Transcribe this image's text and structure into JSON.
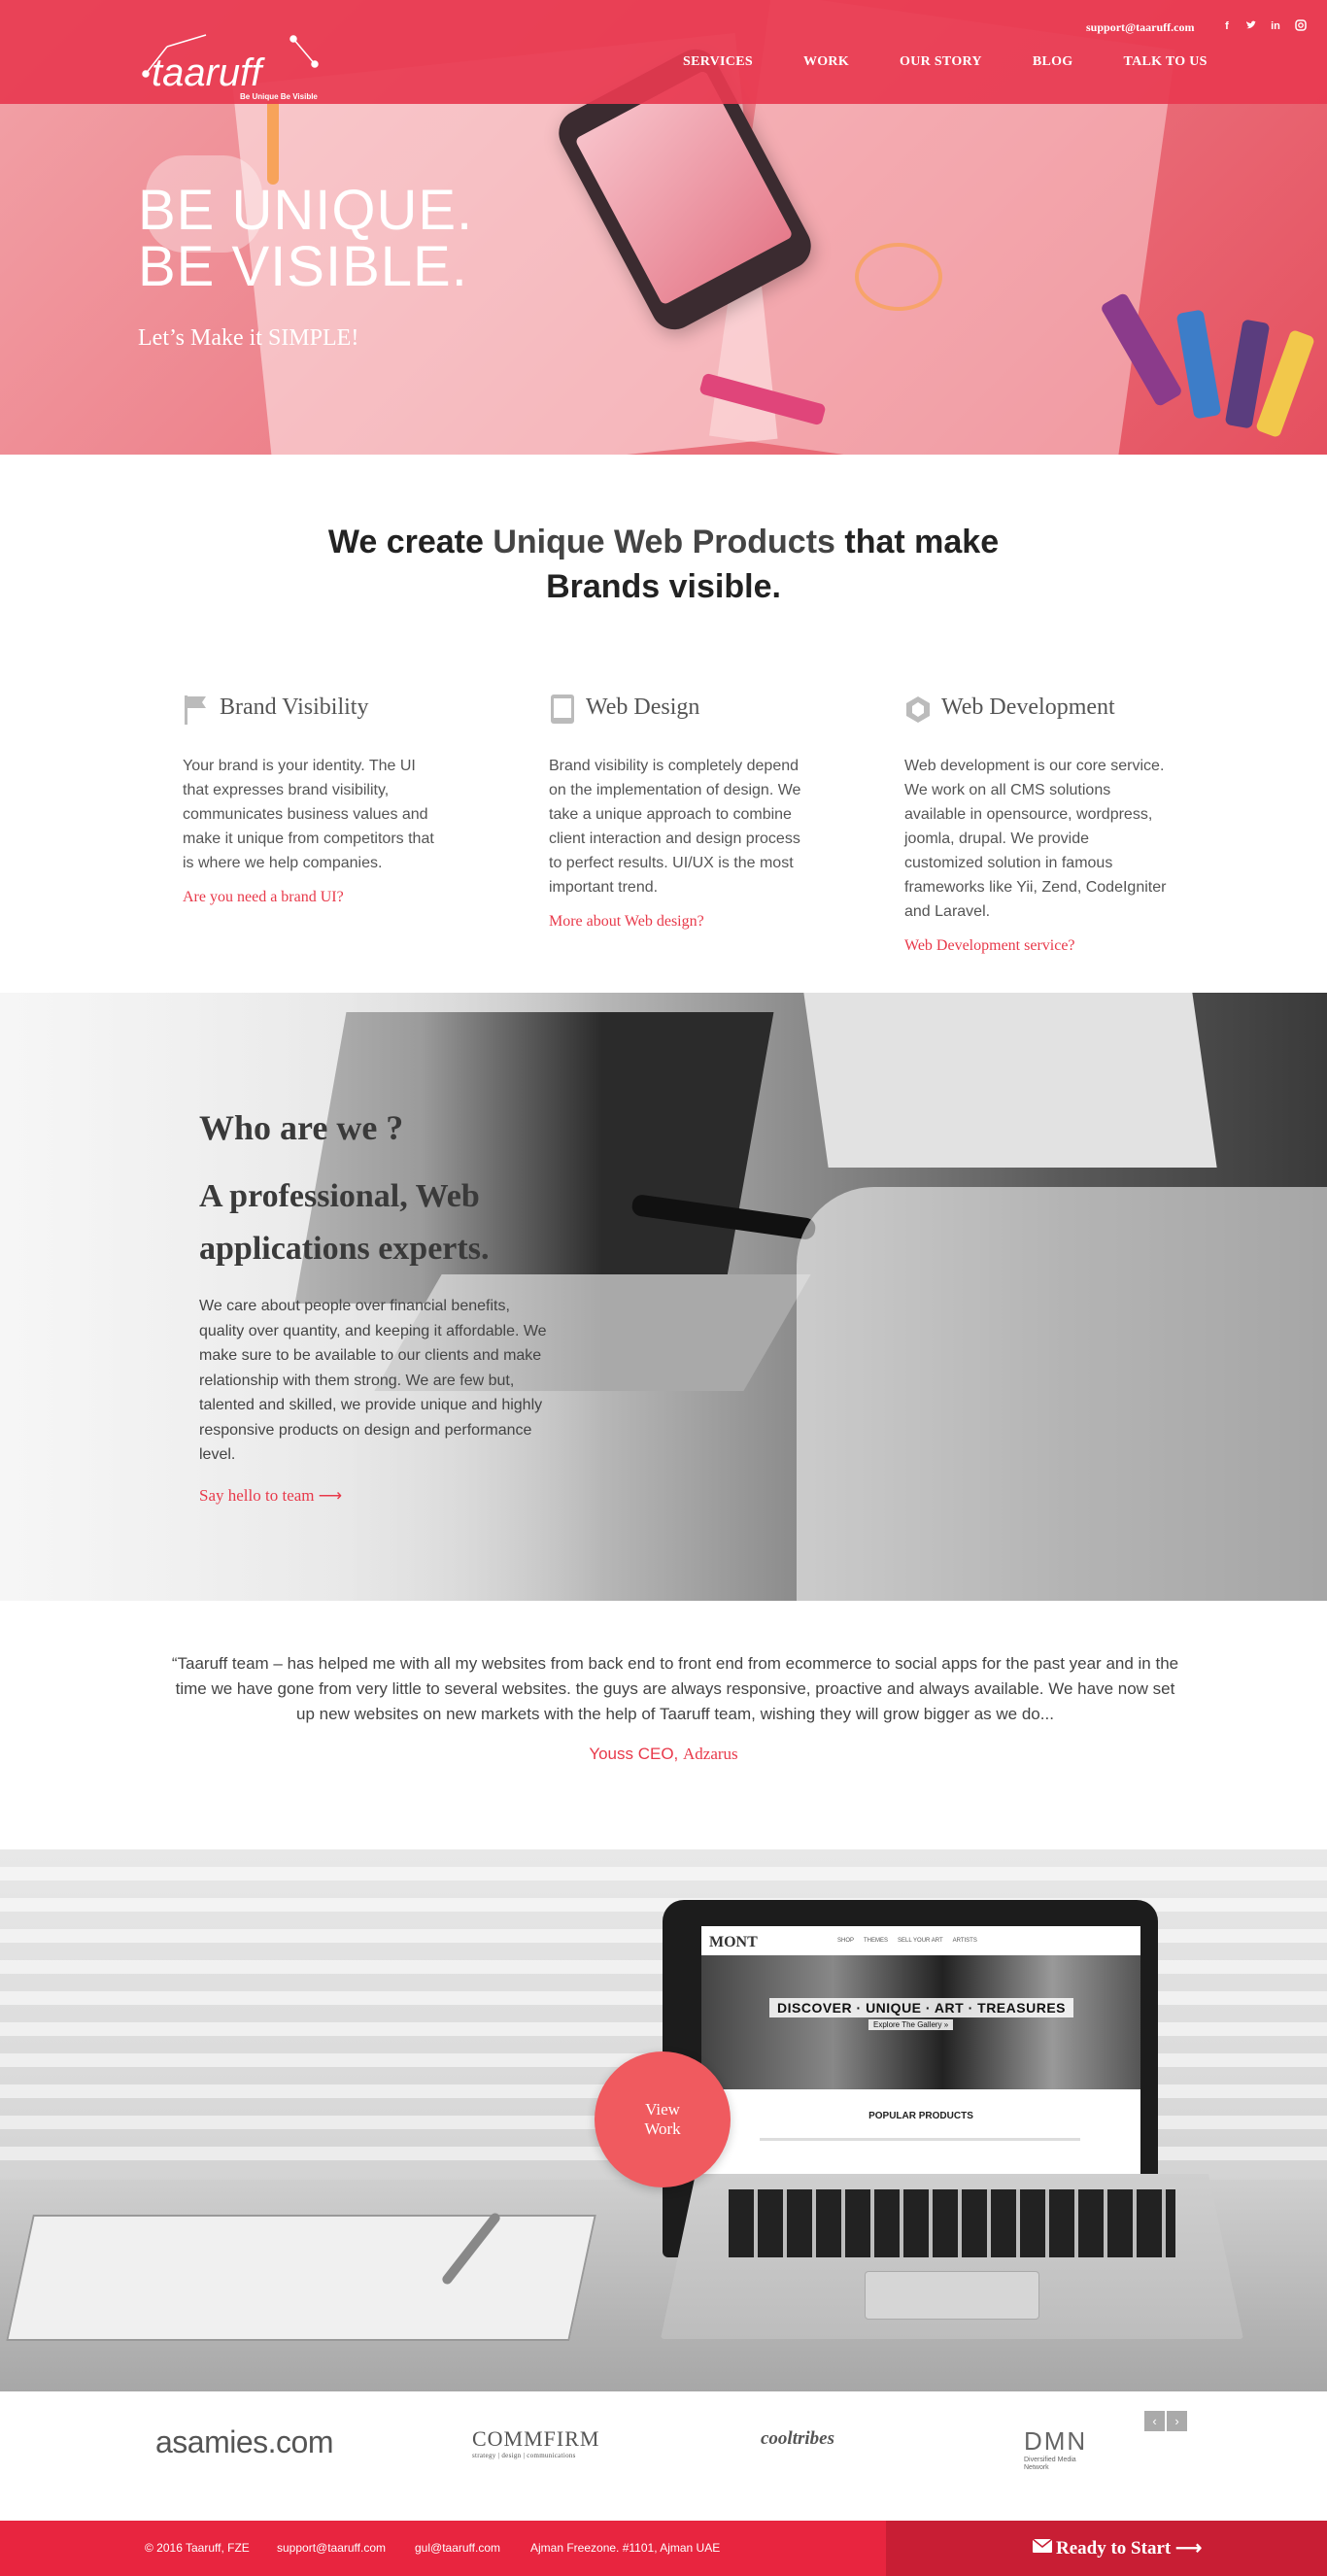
{
  "header": {
    "logo_text": "taaruff",
    "logo_tagline": "Be Unique Be Visible",
    "email": "support@taaruff.com",
    "nav": [
      "SERVICES",
      "WORK",
      "OUR STORY",
      "BLOG",
      "TALK TO US"
    ],
    "social_icons": [
      "facebook-icon",
      "twitter-icon",
      "linkedin-icon",
      "instagram-icon"
    ]
  },
  "hero": {
    "line1": "BE UNIQUE.",
    "line2": "BE VISIBLE.",
    "subtitle": "Let’s Make it SIMPLE!"
  },
  "intro": {
    "pre": "We create ",
    "bold": "Unique Web Products",
    "post": " that make",
    "line2": "Brands visible."
  },
  "features": [
    {
      "icon": "flag-icon",
      "title": "Brand Visibility",
      "body": "Your brand is your identity. The UI that expresses brand visibility, communicates business values and make it unique from competitors that is where we help companies.",
      "link": "Are you need a brand UI?"
    },
    {
      "icon": "tablet-icon",
      "title": "Web Design",
      "body": "Brand visibility is completely depend on the implementation of design. We take a unique approach to combine client interaction and design process to perfect results. UI/UX is the most important trend.",
      "link": "More about Web design?"
    },
    {
      "icon": "hexagon-icon",
      "title": "Web Development",
      "body": "Web development is our core service. We work on all CMS solutions available in opensource, wordpress, joomla, drupal. We provide customized solution in famous frameworks like Yii, Zend, CodeIgniter and Laravel.",
      "link": "Web Development service?"
    }
  ],
  "who": {
    "title": "Who are we ?",
    "subtitle": "A professional, Web applications experts.",
    "body": "We care about people over financial benefits, quality over quantity, and keeping it affordable. We make sure to be available to our clients and make relationship with them strong. We are few but, talented and skilled, we provide unique and highly  responsive products on design and performance level.",
    "link": "Say hello to team ⟶"
  },
  "testimonial": {
    "quote": "“Taaruff team – has helped me with all my websites from back end to front end from ecommerce to social apps for the past year and in the time we have gone from very little to several websites. the guys are always responsive, proactive and always available. We have now set up new websites on new markets with the help of Taaruff team, wishing they will grow bigger as we do...",
    "author": "Youss CEO, ",
    "company": "Adzarus"
  },
  "work": {
    "button_line1": "View",
    "button_line2": "Work",
    "screen_brand": "MONT",
    "screen_nav": [
      "SHOP",
      "THEMES",
      "SELL YOUR ART",
      "ARTISTS"
    ],
    "screen_banner": "DISCOVER · UNIQUE · ART · TREASURES",
    "screen_banner_sub": "Explore The Gallery »",
    "screen_section": "POPULAR  PRODUCTS"
  },
  "clients": {
    "logos": [
      "asamies",
      ".com",
      "COMMFIRM",
      "strategy | design | communications",
      "cooltribes",
      "DMN",
      "Diversified Media Network"
    ],
    "prev": "‹",
    "next": "›"
  },
  "footer": {
    "copyright": "© 2016 Taaruff, FZE",
    "email1": "support@taaruff.com",
    "email2": "gul@taaruff.com",
    "address": "Ajman Freezone. #1101, Ajman UAE",
    "cta": "Ready to Start ⟶"
  },
  "colors": {
    "brand_red": "#e8394a",
    "topbar": "#e83a50",
    "footer": "#e8253f",
    "footer_cta": "#c81e34",
    "view_work": "#f05a5f"
  }
}
